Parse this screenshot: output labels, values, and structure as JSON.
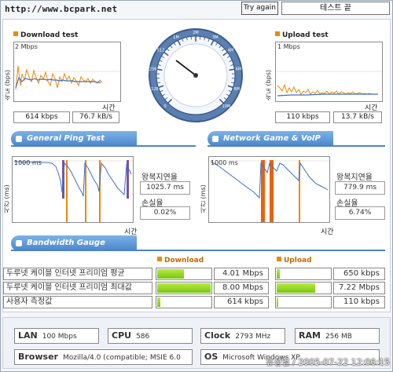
{
  "top": {
    "url": "http://www.bcpark.net",
    "try_again": "Try again",
    "status": "테스트 끝"
  },
  "download": {
    "title": "Download test",
    "y_label": "속도 (bps)",
    "scale": "2 Mbps",
    "x_label": "시간",
    "kbps": "614 kbps",
    "kBs": "76.7 kB/s"
  },
  "upload": {
    "title": "Upload test",
    "y_label": "속도 (bps)",
    "scale": "1 Mbps",
    "x_label": "시간",
    "kbps": "110 kbps",
    "kBs": "13.7 kB/s"
  },
  "gauge": {
    "ticks": [
      "0",
      "128",
      "256",
      "512",
      "1M",
      "2M",
      "3M",
      "4M",
      "6M",
      "8M",
      "10M"
    ]
  },
  "ping": {
    "title": "General Ping Test",
    "y_label": "시간 (ms)",
    "scale": "1000 ms",
    "x_label": "시간",
    "rtt_label": "왕복지연율",
    "rtt_value": "1025.7 ms",
    "loss_label": "손실율",
    "loss_value": "0.02%"
  },
  "game": {
    "title": "Network Game & VoIP Test",
    "y_label": "시간 (ms)",
    "scale": "1000 ms",
    "x_label": "시간",
    "rtt_label": "왕복지연율",
    "rtt_value": "779.9 ms",
    "loss_label": "손실율",
    "loss_value": "6.74%"
  },
  "bandwidth": {
    "title": "Bandwidth Gauge",
    "download_header": "Download",
    "upload_header": "Upload",
    "rows": [
      {
        "label": "두루넷 케이블 인터넷 프리미엄 평균",
        "down": "4.01 Mbps",
        "down_fill": 0.5,
        "up": "650 kbps",
        "up_fill": 0.06
      },
      {
        "label": "두루넷 케이블 인터넷 프리미엄 최대값",
        "down": "8.00 Mbps",
        "down_fill": 1.0,
        "up": "7.22 Mbps",
        "up_fill": 0.72
      },
      {
        "label": "사용자 측정값",
        "down": "614 kbps",
        "down_fill": 0.06,
        "up": "110 kbps",
        "up_fill": 0.02
      }
    ]
  },
  "sysinfo": {
    "lan_label": "LAN",
    "lan_value": "100 Mbps",
    "cpu_label": "CPU",
    "cpu_value": "586",
    "clock_label": "Clock",
    "clock_value": "2793 MHz",
    "ram_label": "RAM",
    "ram_value": "256 MB",
    "browser_label": "Browser",
    "browser_value": "Mozilla/4.0 (compatible; MSIE 6.0",
    "os_label": "OS",
    "os_value": "Microsoft Windows XP"
  },
  "watermark": "유성열 / 2005-07-22 12:06:15",
  "colors": {
    "accent_orange": "#e98a08",
    "ribbon_blue": "#4b84c9",
    "bar_green": "#7ac41a",
    "line_blue": "#3a6fc9"
  }
}
